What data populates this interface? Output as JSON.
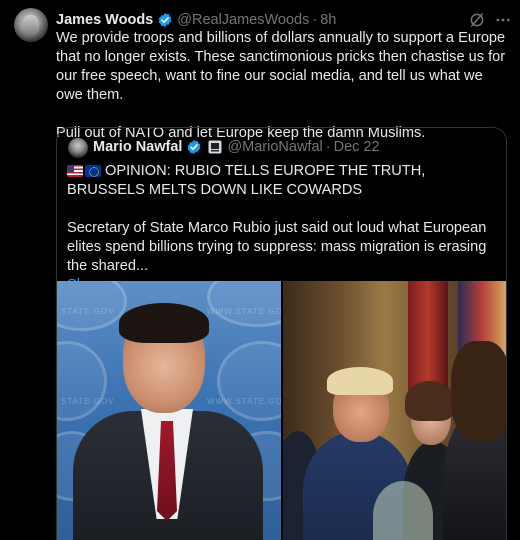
{
  "post": {
    "author_name": "James Woods",
    "author_handle": "@RealJamesWoods",
    "separator": "·",
    "time": "8h",
    "paragraphs": [
      "We provide troops and billions of dollars annually to support a Europe that no longer exists. These sanctimonious pricks then chastise us for our free speech, want to fine our social media, and tell us what we owe them.",
      "Pull out of NATO and let Europe keep the damn Muslims."
    ]
  },
  "quote": {
    "author_name": "Mario Nawfal",
    "author_handle": "@MarioNawfal",
    "separator": "·",
    "date": "Dec 22",
    "headline": "OPINION: RUBIO TELLS EUROPE THE TRUTH, BRUSSELS MELTS DOWN LIKE COWARDS",
    "body": "Secretary of State Marco Rubio just said out loud what European elites spend billions trying to suppress: mass migration is erasing the shared...",
    "show_more": "Show more"
  },
  "colors": {
    "background": "#000000",
    "text": "#e7e9ea",
    "muted": "#71767b",
    "link": "#1d9bf0",
    "verified": "#1d9bf0",
    "border": "#2f3336"
  },
  "icons": [
    "verified-badge-icon",
    "grok-icon",
    "more-icon",
    "affiliate-badge-icon",
    "us-flag-icon",
    "eu-flag-icon"
  ]
}
